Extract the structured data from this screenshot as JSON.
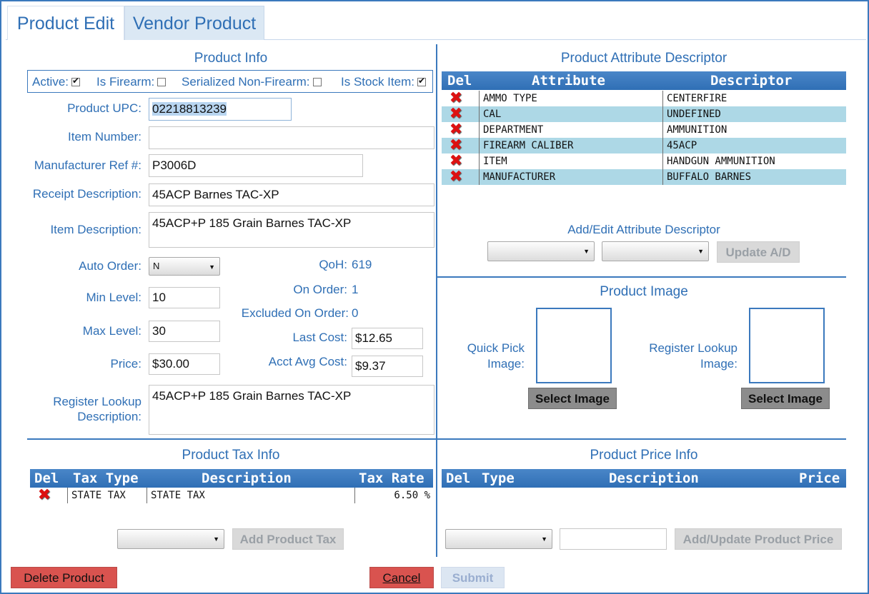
{
  "tabs": [
    {
      "label": "Product Edit",
      "active": true
    },
    {
      "label": "Vendor Product",
      "active": false
    }
  ],
  "product_info": {
    "title": "Product Info",
    "flags": [
      {
        "label": "Active:",
        "checked": true
      },
      {
        "label": "Is Firearm:",
        "checked": false
      },
      {
        "label": "Serialized Non-Firearm:",
        "checked": false
      },
      {
        "label": "Is Stock Item:",
        "checked": true
      }
    ],
    "upc_label": "Product UPC:",
    "upc_value": "02218813239",
    "item_number_label": "Item Number:",
    "item_number_value": "",
    "mfr_ref_label": "Manufacturer Ref #:",
    "mfr_ref_value": "P3006D",
    "receipt_desc_label": "Receipt Description:",
    "receipt_desc_value": "45ACP Barnes TAC-XP",
    "item_desc_label": "Item Description:",
    "item_desc_value": "45ACP+P 185 Grain Barnes TAC-XP",
    "auto_order_label": "Auto Order:",
    "auto_order_value": "N",
    "min_level_label": "Min Level:",
    "min_level_value": "10",
    "max_level_label": "Max Level:",
    "max_level_value": "30",
    "price_label": "Price:",
    "price_value": "$30.00",
    "qoh_label": "QoH:",
    "qoh_value": "619",
    "on_order_label": "On Order:",
    "on_order_value": "1",
    "excluded_label": "Excluded On Order:",
    "excluded_value": "0",
    "last_cost_label": "Last Cost:",
    "last_cost_value": "$12.65",
    "acct_avg_label": "Acct Avg Cost:",
    "acct_avg_value": "$9.37",
    "register_lookup_label_1": "Register Lookup",
    "register_lookup_label_2": "Description:",
    "register_lookup_value": "45ACP+P 185 Grain Barnes TAC-XP"
  },
  "attributes": {
    "title": "Product Attribute Descriptor",
    "headers": {
      "del": "Del",
      "attribute": "Attribute",
      "descriptor": "Descriptor"
    },
    "rows": [
      {
        "attribute": "AMMO TYPE",
        "descriptor": "CENTERFIRE"
      },
      {
        "attribute": "CAL",
        "descriptor": "UNDEFINED"
      },
      {
        "attribute": "DEPARTMENT",
        "descriptor": "AMMUNITION"
      },
      {
        "attribute": "FIREARM CALIBER",
        "descriptor": "45ACP"
      },
      {
        "attribute": "ITEM",
        "descriptor": "HANDGUN AMMUNITION"
      },
      {
        "attribute": "MANUFACTURER",
        "descriptor": "BUFFALO BARNES"
      }
    ],
    "add_edit_title": "Add/Edit Attribute Descriptor",
    "update_button": "Update A/D"
  },
  "image": {
    "title": "Product Image",
    "quick_pick_label_1": "Quick Pick",
    "quick_pick_label_2": "Image:",
    "register_label_1": "Register Lookup",
    "register_label_2": "Image:",
    "select_button": "Select Image"
  },
  "tax": {
    "title": "Product Tax Info",
    "headers": {
      "del": "Del",
      "type": "Tax Type",
      "description": "Description",
      "rate": "Tax Rate"
    },
    "rows": [
      {
        "type": "STATE TAX",
        "description": "STATE TAX",
        "rate": "6.50 %"
      }
    ],
    "add_button": "Add Product Tax"
  },
  "price_info": {
    "title": "Product Price Info",
    "headers": {
      "del": "Del",
      "type": "Type",
      "description": "Description",
      "price": "Price"
    },
    "add_button": "Add/Update Product Price"
  },
  "footer": {
    "delete_button": "Delete Product",
    "cancel_button": "Cancel",
    "submit_button": "Submit"
  },
  "icons": {
    "delete_row": "delete-x-icon",
    "dropdown": "chevron-down-icon"
  }
}
